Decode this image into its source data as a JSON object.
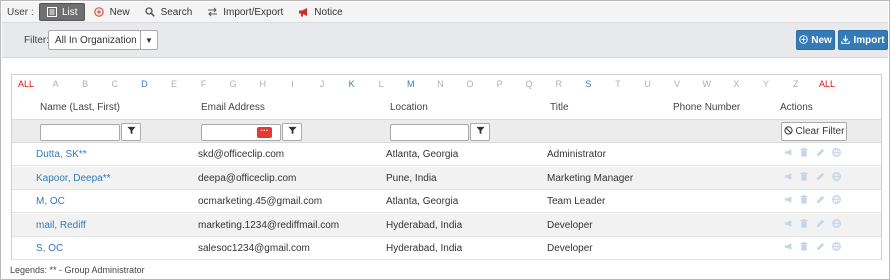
{
  "toolbar": {
    "user_label": "User :",
    "buttons": [
      {
        "label": "List",
        "icon": "list-icon"
      },
      {
        "label": "New",
        "icon": "plus-circle-icon"
      },
      {
        "label": "Search",
        "icon": "search-icon"
      },
      {
        "label": "Import/Export",
        "icon": "import-export-icon"
      },
      {
        "label": "Notice",
        "icon": "megaphone-icon"
      }
    ]
  },
  "filter": {
    "label": "Filter:",
    "selected": "All In Organization"
  },
  "header_buttons": {
    "new_label": "New",
    "import_label": "Import"
  },
  "alphabet": [
    "ALL",
    "A",
    "B",
    "C",
    "D",
    "E",
    "F",
    "G",
    "H",
    "I",
    "J",
    "K",
    "L",
    "M",
    "N",
    "O",
    "P",
    "Q",
    "R",
    "S",
    "T",
    "U",
    "V",
    "W",
    "X",
    "Y",
    "Z",
    "ALL"
  ],
  "alphabet_active": [
    "D",
    "K",
    "M",
    "S"
  ],
  "columns": {
    "name": "Name (Last, First)",
    "email": "Email Address",
    "location": "Location",
    "title": "Title",
    "phone": "Phone Number",
    "actions": "Actions"
  },
  "clear_filter_label": "Clear Filter",
  "rows": [
    {
      "name": "Dutta, SK**",
      "email": "skd@officeclip.com",
      "location": "Atlanta, Georgia",
      "title": "Administrator",
      "phone": ""
    },
    {
      "name": "Kapoor, Deepa**",
      "email": "deepa@officeclip.com",
      "location": "Pune, India",
      "title": "Marketing Manager",
      "phone": ""
    },
    {
      "name": "M, OC",
      "email": "ocmarketing.45@gmail.com",
      "location": "Atlanta, Georgia",
      "title": "Team Leader",
      "phone": ""
    },
    {
      "name": "mail, Rediff",
      "email": "marketing.1234@rediffmail.com",
      "location": "Hyderabad, India",
      "title": "Developer",
      "phone": ""
    },
    {
      "name": "S, OC",
      "email": "salesoc1234@gmail.com",
      "location": "Hyderabad, India",
      "title": "Developer",
      "phone": ""
    }
  ],
  "legend": "Legends: ** - Group Administrator",
  "colors": {
    "accent": "#337ab7",
    "alpha_all": "#e01010",
    "alpha_disabled": "#b0b0b0",
    "toolbar_active": "#6f6f6f"
  }
}
